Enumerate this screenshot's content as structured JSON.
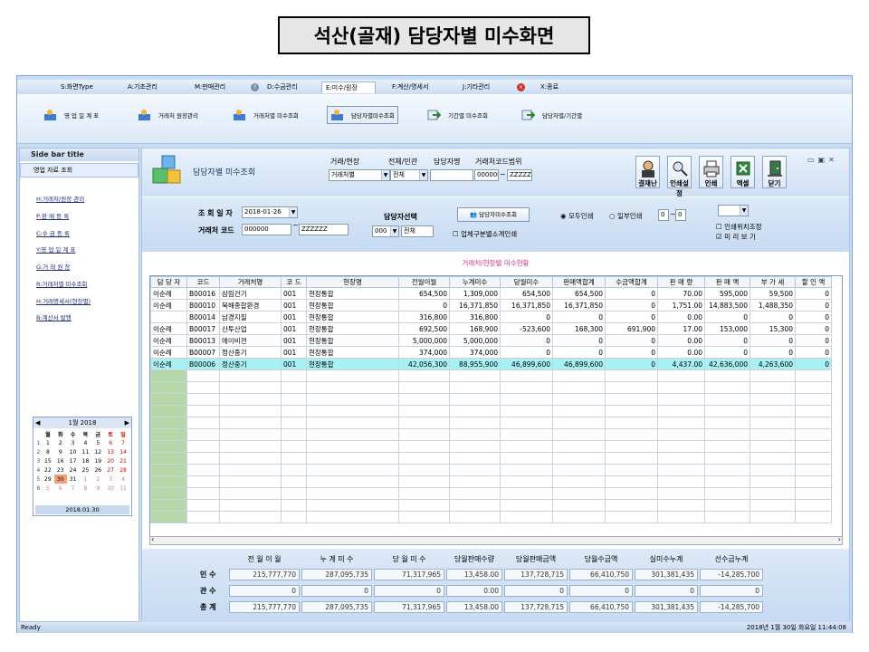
{
  "slide_title": "석산(골재) 담당자별 미수화면",
  "tabs": [
    "S:화면Type",
    "A:기초관리",
    "M:판매관리",
    "D:수금관리",
    "E:미수/원장",
    "F:계산/명세서",
    "J:기타관리",
    "X:종료"
  ],
  "ribbon": [
    "영 업 일 계 표",
    "거래처 원장관리",
    "거래처별 미수조회",
    "담당자별미수조회",
    "기간별 미수조회",
    "담당자별/기간별"
  ],
  "sidebar": {
    "title": "Side bar title",
    "group": "영업 자료 조회",
    "items": [
      "H:거래처/원장 관리",
      "P:판 매 등 록",
      "C:수 금 등 록",
      "Y:영 업 일 계 표",
      "G:거 래 원 장",
      "R:거래처별 미수조회",
      "H:거래명세서(현장별)",
      "B:계산서 발행"
    ]
  },
  "calendar": {
    "month": "1월 2018",
    "days": [
      "월",
      "화",
      "수",
      "목",
      "금",
      "토",
      "일"
    ],
    "weeks": [
      [
        "1",
        "2",
        "3",
        "4",
        "5",
        "6",
        "7"
      ],
      [
        "8",
        "9",
        "10",
        "11",
        "12",
        "13",
        "14"
      ],
      [
        "15",
        "16",
        "17",
        "18",
        "19",
        "20",
        "21"
      ],
      [
        "22",
        "23",
        "24",
        "25",
        "26",
        "27",
        "28"
      ],
      [
        "29",
        "30",
        "31",
        "1",
        "2",
        "3",
        "4"
      ],
      [
        "5",
        "6",
        "7",
        "8",
        "9",
        "10",
        "11"
      ]
    ],
    "week_nums": [
      "1",
      "2",
      "3",
      "4",
      "5",
      "6"
    ],
    "footer": "2018.01.30"
  },
  "top": {
    "title": "담당자별 미수조회",
    "lbl_type": "거래/현장",
    "val_type": "거래처별",
    "lbl_all": "전체/민관",
    "val_all": "전체",
    "lbl_mgr": "담당자명",
    "lbl_range": "거래처코드범위",
    "range_from": "000000",
    "range_to": "ZZZZZ",
    "buttons": [
      "결재난",
      "인쇄설정",
      "인쇄",
      "엑셀",
      "닫기"
    ]
  },
  "form": {
    "lbl_date": "조 회 일 자",
    "date": "2018-01-26",
    "lbl_code": "거래처 코드",
    "code_from": "000000",
    "code_to": "ZZZZZZ",
    "lbl_mgrsel": "담당자선택",
    "mgr_code": "000",
    "mgr_name": "전체",
    "query_btn": "담당자미수조회",
    "chk_sub": "업체구분별소계인쇄",
    "radio_all": "모두인쇄",
    "radio_part": "일부인쇄",
    "part_from": "0",
    "part_to": "0",
    "chk_pos": "인쇄위치조정",
    "chk_preview": "미 리 보 기"
  },
  "grid_title": "거래처/현장별 미수현황",
  "columns": [
    "담 당 자",
    "코드",
    "거래처명",
    "코 드",
    "현장명",
    "전월이월",
    "누계미수",
    "당월미수",
    "판매액합계",
    "수금액합계",
    "판 매 량",
    "판 매 액",
    "부 가 세",
    "할 인 액"
  ],
  "rows": [
    [
      "이순례",
      "B00016",
      "삼림건기",
      "001",
      "현장통합",
      "654,500",
      "1,309,000",
      "654,500",
      "654,500",
      "0",
      "70.00",
      "595,000",
      "59,500",
      "0"
    ],
    [
      "이순례",
      "B00010",
      "북해종합환경",
      "001",
      "현장통합",
      "0",
      "16,371,850",
      "16,371,850",
      "16,371,850",
      "0",
      "1,751.00",
      "14,883,500",
      "1,488,350",
      "0"
    ],
    [
      "",
      "B00014",
      "남경지질",
      "001",
      "현장통합",
      "316,800",
      "316,800",
      "0",
      "0",
      "0",
      "0.00",
      "0",
      "0",
      "0"
    ],
    [
      "이순례",
      "B00017",
      "산투산업",
      "001",
      "현장통합",
      "692,500",
      "168,900",
      "-523,600",
      "168,300",
      "691,900",
      "17.00",
      "153,000",
      "15,300",
      "0"
    ],
    [
      "이순례",
      "B00013",
      "에이비젼",
      "001",
      "현장통합",
      "5,000,000",
      "5,000,000",
      "0",
      "0",
      "0",
      "0.00",
      "0",
      "0",
      "0"
    ],
    [
      "이순례",
      "B00007",
      "정산중기",
      "001",
      "현장통합",
      "374,000",
      "374,000",
      "0",
      "0",
      "0",
      "0.00",
      "0",
      "0",
      "0"
    ],
    [
      "이순례",
      "B00006",
      "정산중기",
      "001",
      "현장통합",
      "42,056,300",
      "88,955,900",
      "46,899,600",
      "46,899,600",
      "0",
      "4,437.00",
      "42,636,000",
      "4,263,600",
      "0"
    ]
  ],
  "summary": {
    "headers": [
      "전 월 이 월",
      "누 계 미 수",
      "당 월 미 수",
      "당월판매수량",
      "당월판매금액",
      "당월수금액",
      "실미수누계",
      "선수금누계"
    ],
    "rows": [
      {
        "label": "민 수",
        "values": [
          "215,777,770",
          "287,095,735",
          "71,317,965",
          "13,458.00",
          "137,728,715",
          "66,410,750",
          "301,381,435",
          "-14,285,700"
        ]
      },
      {
        "label": "관 수",
        "values": [
          "0",
          "0",
          "0",
          "0.00",
          "0",
          "0",
          "0",
          "0"
        ]
      },
      {
        "label": "총 계",
        "values": [
          "215,777,770",
          "287,095,735",
          "71,317,965",
          "13,458.00",
          "137,728,715",
          "66,410,750",
          "301,381,435",
          "-14,285,700"
        ]
      }
    ]
  },
  "status": {
    "left": "Ready",
    "right": "2018년 1월 30일 화요일 11:44:08"
  }
}
